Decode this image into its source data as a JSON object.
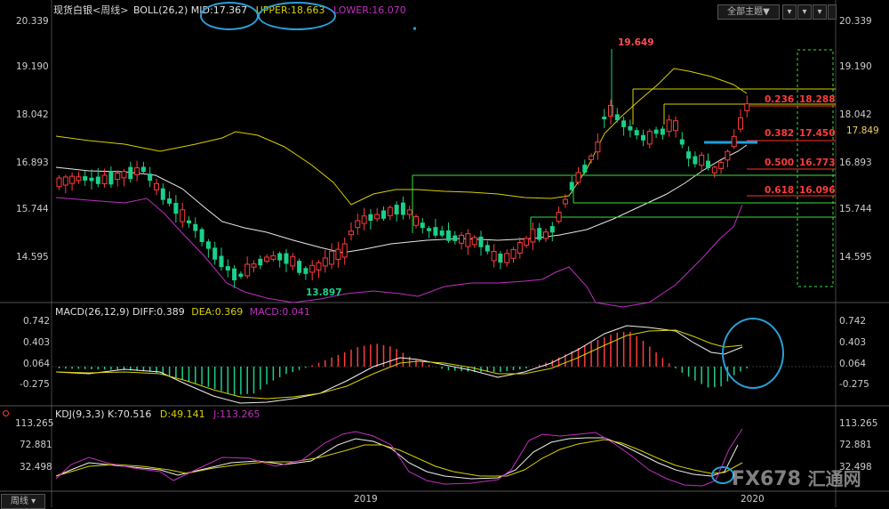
{
  "header": {
    "instrument": "现货白银",
    "period_label": "<周线>",
    "indicator": "BOLL(26,2)",
    "mid": "MID:17.367",
    "upper": "UPPER:18.663",
    "lower": "LOWER:16.070",
    "all_topics_btn": "全部主题▼"
  },
  "colors": {
    "bull": "#1ad08a",
    "bear": "#ff3b3b",
    "mid": "#f0f0f0",
    "upper": "#d8d000",
    "lower": "#c02ec0",
    "annot": "#1aa0e0",
    "fib": "#38e038"
  },
  "price_axis": {
    "ticks": [
      "20.339",
      "19.190",
      "18.042",
      "16.893",
      "15.744",
      "14.595"
    ],
    "current": "17.849"
  },
  "price_annotations": {
    "high": "19.649",
    "low": "13.897"
  },
  "fib_levels": [
    {
      "ratio": "0.236",
      "price": "18.288"
    },
    {
      "ratio": "0.382",
      "price": "17.450"
    },
    {
      "ratio": "0.500",
      "price": "16.773"
    },
    {
      "ratio": "0.618",
      "price": "16.096"
    }
  ],
  "macd": {
    "title": "MACD(26,12,9)",
    "diff": "DIFF:0.389",
    "dea": "DEA:0.369",
    "macd": "MACD:0.041",
    "ticks": [
      "0.742",
      "0.403",
      "0.064",
      "-0.275"
    ]
  },
  "kdj": {
    "title": "KDJ(9,3,3)",
    "k": "K:70.516",
    "d": "D:49.141",
    "j": "J:113.265",
    "ticks": [
      "113.265",
      "72.881",
      "32.498"
    ]
  },
  "time_axis": {
    "period_btn": "周线",
    "labels": [
      "2019",
      "2020"
    ]
  },
  "watermark": {
    "text": "FX678",
    "cn": "汇通网"
  }
}
